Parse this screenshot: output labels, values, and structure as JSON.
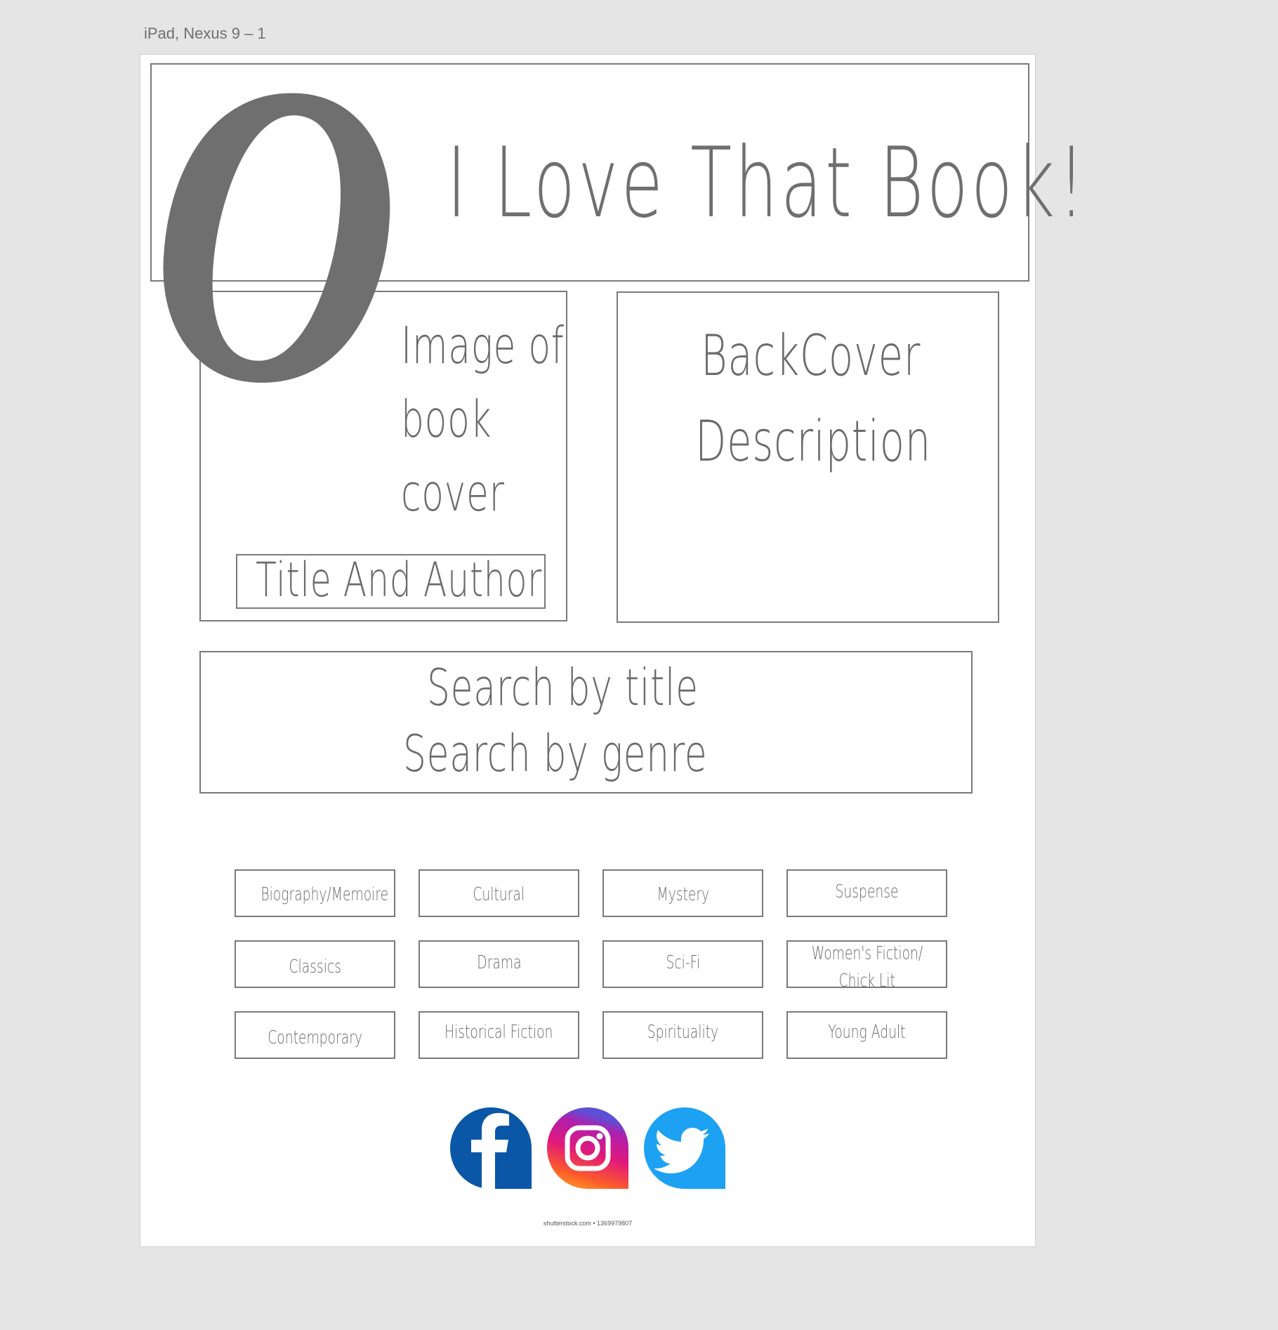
{
  "artboard": {
    "label": "iPad, Nexus 9 – 1"
  },
  "header": {
    "logo_letter": "O",
    "title": "I Love That Book!"
  },
  "cover": {
    "lines": [
      "Image of",
      "book",
      "cover"
    ],
    "title_author": "Title And Author"
  },
  "backcover": {
    "lines": [
      "BackCover",
      "Description"
    ]
  },
  "search": {
    "by_title": "Search by title",
    "by_genre": "Search by genre"
  },
  "genres": [
    [
      "Biography/Memoire",
      "Cultural",
      "Mystery",
      "Suspense"
    ],
    [
      "Classics",
      "Drama",
      "Sci-Fi",
      "Women's Fiction/ Chick Lit"
    ],
    [
      "Contemporary",
      "Historical Fiction",
      "Spirituality",
      "Young Adult"
    ]
  ],
  "genre_two_line": {
    "line1": "Women's Fiction/",
    "line2": "Chick Lit"
  },
  "social": {
    "icons": [
      "facebook-icon",
      "instagram-icon",
      "twitter-icon"
    ]
  },
  "credit": "shutterstock.com • 1369979807",
  "colors": {
    "sketch": "#6b6b6b",
    "facebook": "#0a57a8",
    "twitter": "#1da1f2"
  }
}
